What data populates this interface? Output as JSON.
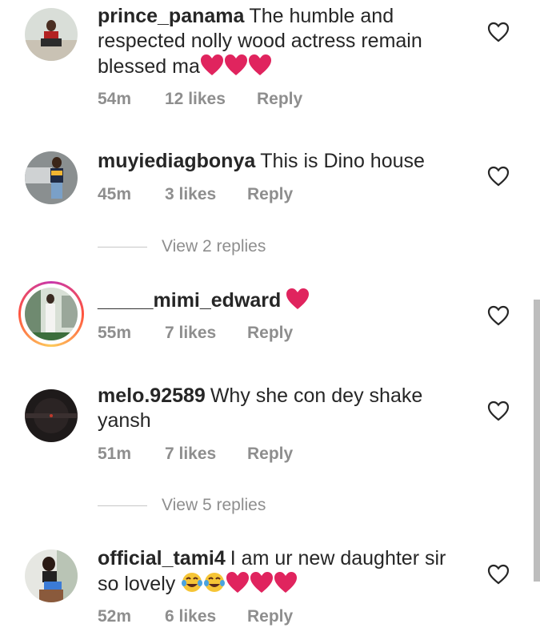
{
  "comments": [
    {
      "username": "prince_panama",
      "text": "The humble and respected nolly wood actress remain blessed ma",
      "emoji": [
        "red-heart",
        "red-heart",
        "red-heart"
      ],
      "time": "54m",
      "likes": "12 likes",
      "reply": "Reply"
    },
    {
      "username": "muyiediagbonya",
      "text": "This is Dino house",
      "emoji": [],
      "time": "45m",
      "likes": "3 likes",
      "reply": "Reply",
      "view_replies": "View 2 replies"
    },
    {
      "username": "_____mimi_edward",
      "text": "",
      "emoji": [
        "red-heart"
      ],
      "time": "55m",
      "likes": "7 likes",
      "reply": "Reply",
      "has_story_ring": true
    },
    {
      "username": "melo.92589",
      "text": "Why she con dey shake yansh",
      "emoji": [],
      "time": "51m",
      "likes": "7 likes",
      "reply": "Reply",
      "view_replies": "View 5 replies"
    },
    {
      "username": "official_tami4",
      "text": "I am ur new daughter sir so lovely",
      "emoji": [
        "tears-of-joy",
        "tears-of-joy",
        "red-heart",
        "red-heart",
        "red-heart"
      ],
      "time": "52m",
      "likes": "6 likes",
      "reply": "Reply"
    }
  ],
  "colors": {
    "text": "#262626",
    "meta": "#8e8e8e",
    "heart": "#e0245e"
  }
}
